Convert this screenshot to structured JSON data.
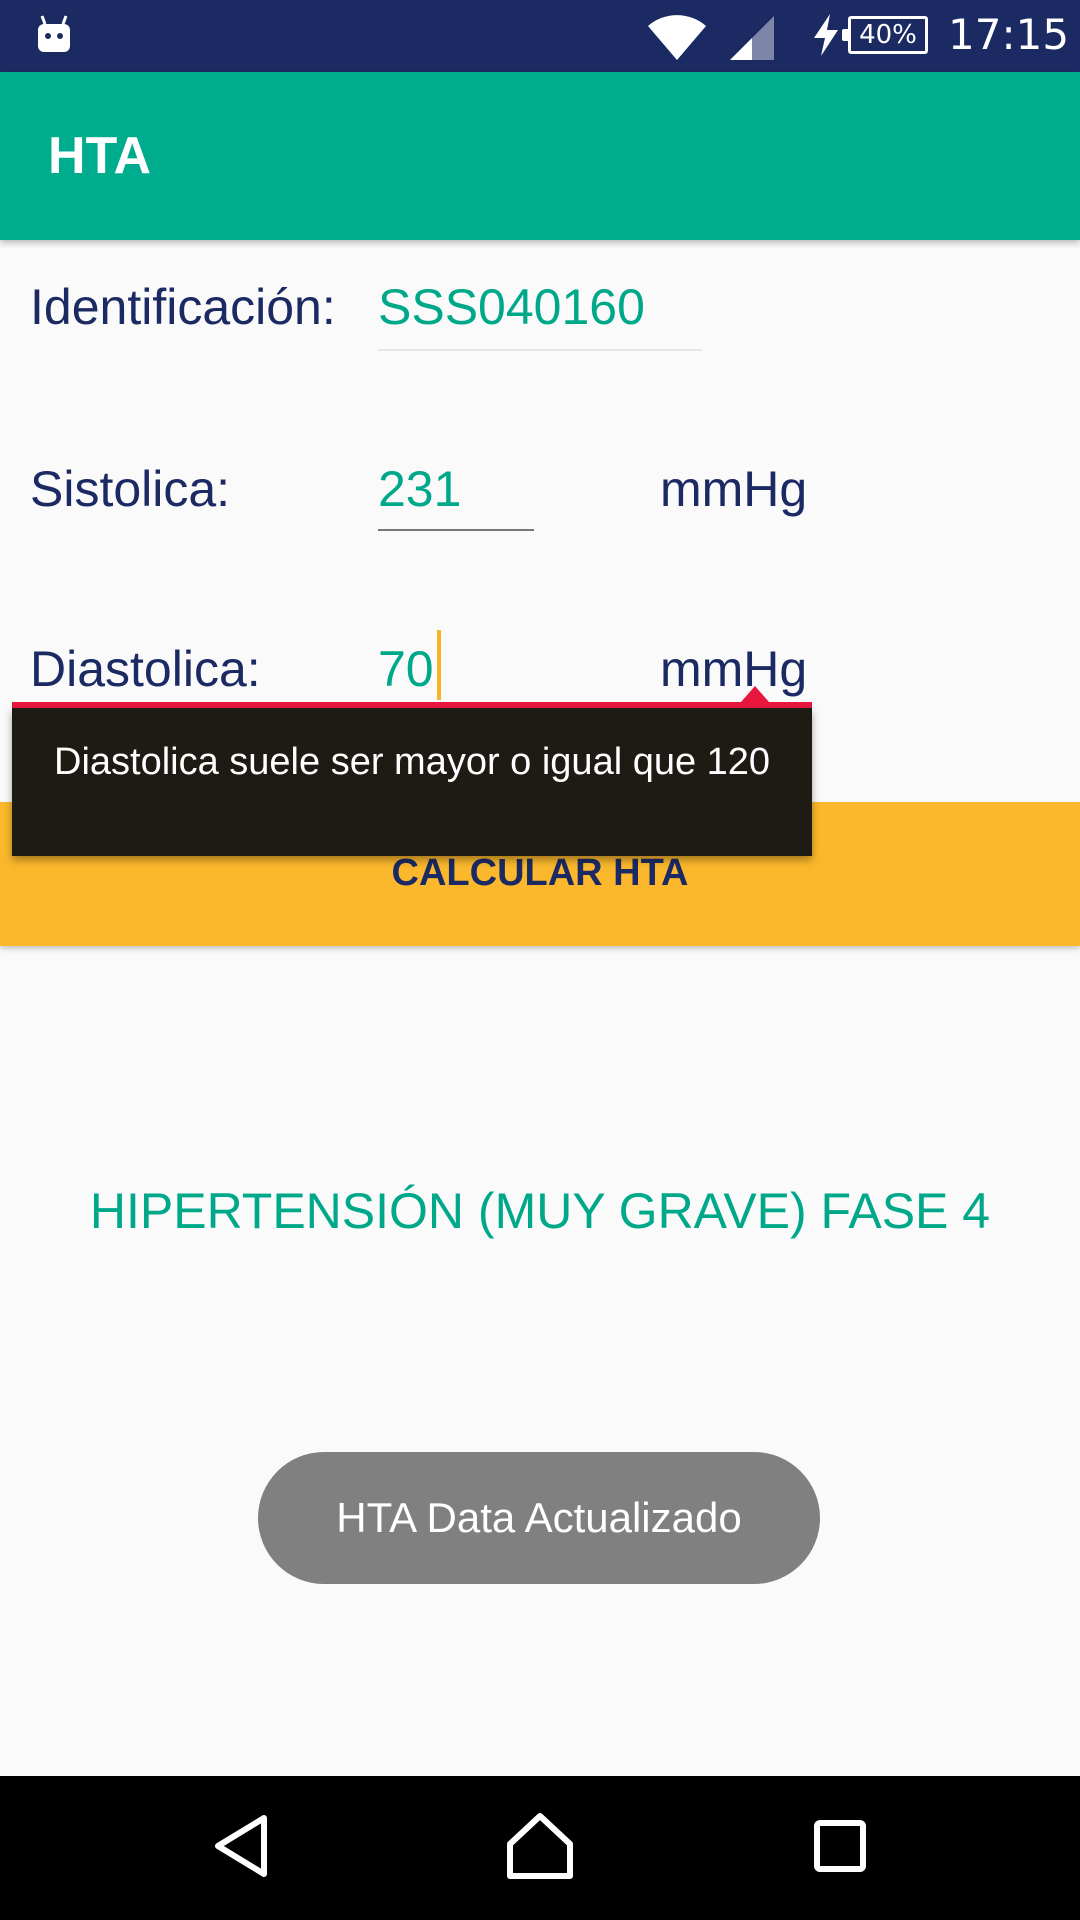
{
  "status_bar": {
    "time": "17:15",
    "battery": "40%",
    "icons": [
      "android-icon",
      "wifi-icon",
      "signal-icon",
      "charging-icon",
      "battery-icon"
    ]
  },
  "app_bar": {
    "title": "HTA"
  },
  "form": {
    "id_label": "Identificación:",
    "id_value": "SSS040160",
    "systolic_label": "Sistolica:",
    "systolic_value": "231",
    "systolic_unit": "mmHg",
    "diastolic_label": "Diastolica:",
    "diastolic_value": "70",
    "diastolic_unit": "mmHg",
    "error_message": "Diastolica suele ser mayor o igual que 120"
  },
  "calculate_button": {
    "label": "CALCULAR HTA"
  },
  "result": {
    "text": "HIPERTENSIÓN (MUY GRAVE) FASE 4"
  },
  "toast": {
    "text": "HTA Data Actualizado"
  },
  "colors": {
    "status_bar": "#1b2a63",
    "app_bar": "#00ac8e",
    "accent_text": "#00a88a",
    "button": "#fbb82c",
    "error": "#e8173d",
    "label_text": "#1b2a63"
  },
  "nav_bar": {
    "icons": [
      "back-icon",
      "home-icon",
      "recents-icon"
    ]
  }
}
